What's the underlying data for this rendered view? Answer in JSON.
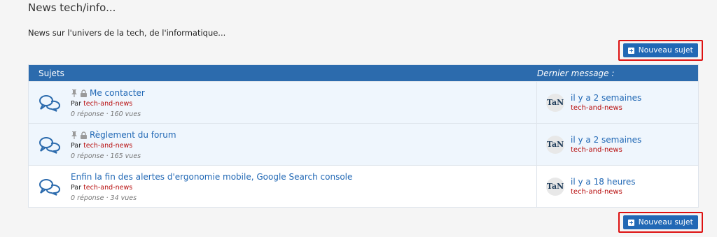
{
  "page": {
    "title": "News tech/info...",
    "description": "News sur l'univers de la tech, de l'informatique..."
  },
  "actions": {
    "new_topic_label": "Nouveau sujet"
  },
  "table": {
    "header_topics": "Sujets",
    "header_last": "Dernier message :",
    "by_prefix": "Par",
    "rows": [
      {
        "title": "Me contacter",
        "pinned": true,
        "locked": true,
        "author": "tech-and-news",
        "stats": "0 réponse · 160 vues",
        "last_when": "il y a 2 semaines",
        "last_author": "tech-and-news",
        "avatar_text": "TaN"
      },
      {
        "title": "Règlement du forum",
        "pinned": true,
        "locked": true,
        "author": "tech-and-news",
        "stats": "0 réponse · 165 vues",
        "last_when": "il y a 2 semaines",
        "last_author": "tech-and-news",
        "avatar_text": "TaN"
      },
      {
        "title": "Enfin la fin des alertes d'ergonomie mobile, Google Search console",
        "pinned": false,
        "locked": false,
        "author": "tech-and-news",
        "stats": "0 réponse · 34 vues",
        "last_when": "il y a 18 heures",
        "last_author": "tech-and-news",
        "avatar_text": "TaN"
      }
    ]
  },
  "colors": {
    "accent": "#2168b5",
    "header_bg": "#2c6bad",
    "author": "#b80f0f",
    "highlight_border": "#dd1111"
  },
  "icons": [
    "chat-bubbles-icon",
    "pin-icon",
    "lock-icon",
    "plus-icon"
  ]
}
